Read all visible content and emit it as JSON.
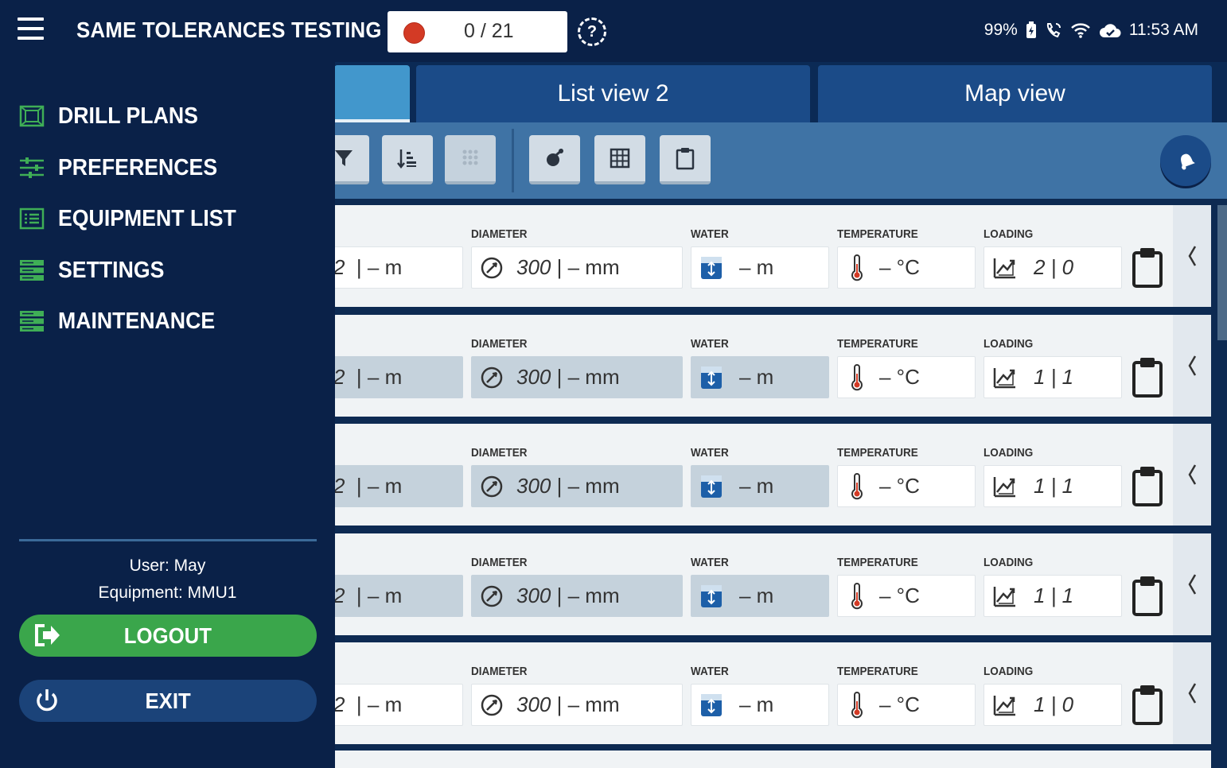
{
  "app": {
    "title": "SAME TOLERANCES TESTING",
    "progress": "0 / 21",
    "status": {
      "battery": "99%",
      "time": "11:53 AM"
    }
  },
  "tabs": [
    {
      "label": ""
    },
    {
      "label": "List view 2"
    },
    {
      "label": "Map view"
    }
  ],
  "columns": {
    "diameter": "DIAMETER",
    "water": "WATER",
    "temperature": "TEMPERATURE",
    "loading": "LOADING"
  },
  "rows": [
    {
      "depth_partial": "2",
      "depth_unit": "|  –  m",
      "diameter": "300",
      "diameter_unit": "| –  mm",
      "water": "–  m",
      "temperature": "–  °C",
      "loading": "2 | 0"
    },
    {
      "depth_partial": "2",
      "depth_unit": "|  –  m",
      "diameter": "300",
      "diameter_unit": "| –  mm",
      "water": "–  m",
      "temperature": "–  °C",
      "loading": "1 | 1"
    },
    {
      "depth_partial": "2",
      "depth_unit": "|  –  m",
      "diameter": "300",
      "diameter_unit": "| –  mm",
      "water": "–  m",
      "temperature": "–  °C",
      "loading": "1 | 1"
    },
    {
      "depth_partial": "2",
      "depth_unit": "|  –  m",
      "diameter": "300",
      "diameter_unit": "| –  mm",
      "water": "–  m",
      "temperature": "–  °C",
      "loading": "1 | 1"
    },
    {
      "depth_partial": "2",
      "depth_unit": "|  –  m",
      "diameter": "300",
      "diameter_unit": "| –  mm",
      "water": "–  m",
      "temperature": "–  °C",
      "loading": "1 | 0"
    }
  ],
  "drawer": {
    "items": [
      {
        "label": "DRILL PLANS",
        "icon": "drill-plans-icon"
      },
      {
        "label": "PREFERENCES",
        "icon": "sliders-icon"
      },
      {
        "label": "EQUIPMENT LIST",
        "icon": "list-icon"
      },
      {
        "label": "SETTINGS",
        "icon": "server-icon"
      },
      {
        "label": "MAINTENANCE",
        "icon": "server-icon"
      }
    ],
    "user": "User: May",
    "equipment": "Equipment: MMU1",
    "logout": "LOGOUT",
    "exit": "EXIT"
  },
  "colors": {
    "header": "#0a2148",
    "tab_active": "#4297cc",
    "tab": "#1b4b88",
    "toolbar": "#3f73a5",
    "logout": "#3aa64b",
    "record": "#d33a25",
    "nav_icon": "#3fae56"
  }
}
